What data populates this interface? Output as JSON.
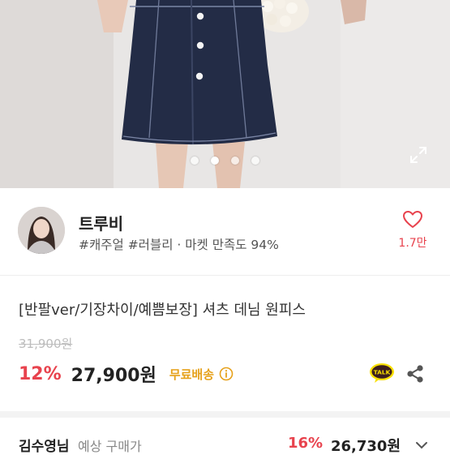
{
  "seller": {
    "name": "트루비",
    "tags": "#캐주얼 #러블리 · 마켓 만족도 94%",
    "likes": "1.7만"
  },
  "product": {
    "title": "[반팔ver/기장차이/예쁨보장] 셔츠 데님 원피스",
    "original_price": "31,900원",
    "discount": "12%",
    "price": "27,900원",
    "shipping": "무료배송"
  },
  "carousel": {
    "total": 4,
    "active_index": 1
  },
  "bottom_offer": {
    "user": "김수영님",
    "label": "예상 구매가",
    "discount": "16%",
    "price": "26,730원"
  },
  "icons": {
    "expand": "expand-icon",
    "heart": "heart-outline-icon",
    "info": "info-circle-icon",
    "kakao_talk": "kakao-talk-icon",
    "share": "share-icon",
    "chevron": "chevron-down-icon"
  },
  "colors": {
    "accent_red": "#e8434e",
    "shipping_yellow": "#e6a11a",
    "kakao_yellow": "#f9e000"
  }
}
